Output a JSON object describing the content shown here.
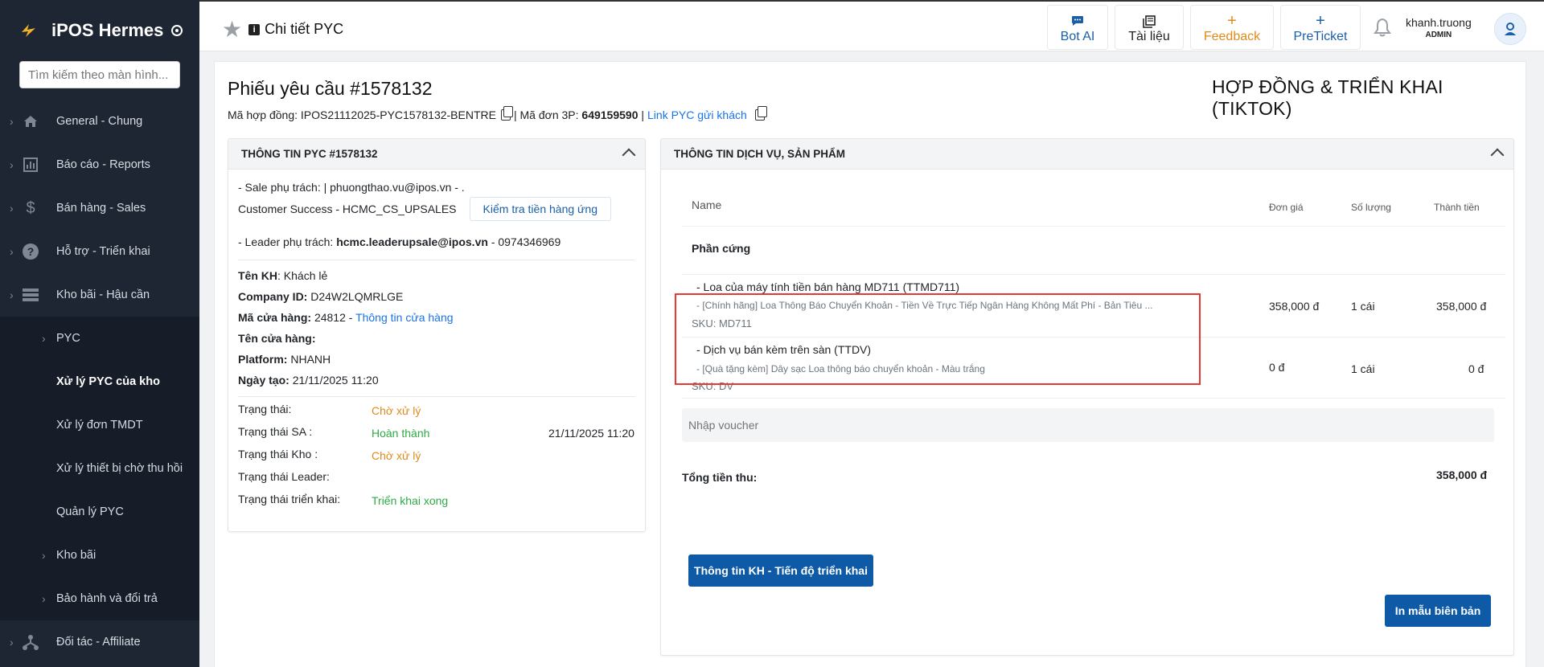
{
  "app": {
    "name": "iPOS Hermes"
  },
  "search": {
    "placeholder": "Tìm kiếm theo màn hình..."
  },
  "sidebar": {
    "items": [
      {
        "label": "General - Chung",
        "icon": "home-icon"
      },
      {
        "label": "Báo cáo - Reports",
        "icon": "report-chart-icon"
      },
      {
        "label": "Bán hàng - Sales",
        "icon": "dollar-icon"
      },
      {
        "label": "Hỗ trợ - Triển khai",
        "icon": "help-icon"
      },
      {
        "label": "Kho bãi - Hậu cần",
        "icon": "warehouse-list-icon"
      }
    ],
    "sub_items": [
      {
        "label": "PYC"
      },
      {
        "label": "Xử lý PYC của kho"
      },
      {
        "label": "Xử lý đơn TMDT"
      },
      {
        "label": "Xử lý thiết bị chờ thu hồi"
      },
      {
        "label": "Quản lý PYC"
      },
      {
        "label": "Kho bãi"
      },
      {
        "label": "Bảo hành và đổi trả"
      }
    ],
    "bottom_item": {
      "label": "Đối tác - Affiliate",
      "icon": "affiliate-icon"
    }
  },
  "topbar": {
    "title": "Chi tiết PYC",
    "buttons": [
      {
        "label": "Bot AI",
        "icon": "chat-icon"
      },
      {
        "label": "Tài liệu",
        "icon": "docs-icon"
      },
      {
        "label": "Feedback",
        "icon": "plus-icon"
      },
      {
        "label": "PreTicket",
        "icon": "plus-icon"
      }
    ],
    "user": {
      "name": "khanh.truong",
      "role": "ADMIN"
    }
  },
  "page": {
    "title": "Phiếu yêu cầu #1578132",
    "header_right": "HỢP ĐỒNG & TRIỂN KHAI (TIKTOK)",
    "contract_label": "Mã hợp đồng:",
    "contract_value": "IPOS21112025-PYC1578132-BENTRE",
    "order_label": "| Mã đơn 3P:",
    "order_value": "649159590",
    "pipe": "|",
    "link_label": "Link PYC gửi khách"
  },
  "left_panel": {
    "title": "THÔNG TIN PYC #1578132",
    "sale_line": "- Sale phụ trách: | phuongthao.vu@ipos.vn - .",
    "cs_line": "Customer Success - HCMC_CS_UPSALES",
    "check_button": "Kiểm tra tiền hàng ứng",
    "leader_prefix": "- Leader phụ trách:",
    "leader_email": "hcmc.leaderupsale@ipos.vn",
    "leader_phone": "- 0974346969",
    "customer_label": "Tên KH",
    "customer_value": ": Khách lẻ",
    "company_label": "Company ID:",
    "company_value": "D24W2LQMRLGE",
    "store_code_label": "Mã cửa hàng:",
    "store_code_value": "24812 -",
    "store_info_link": "Thông tin cửa hàng",
    "store_name_label": "Tên cửa hàng:",
    "platform_label": "Platform:",
    "platform_value": "NHANH",
    "created_label": "Ngày tạo:",
    "created_value": "21/11/2025 11:20",
    "statuses": [
      {
        "label": "Trạng thái:",
        "value": "Chờ xử lý",
        "color": "#e08a1c",
        "date": ""
      },
      {
        "label": "Trạng thái SA :",
        "value": "Hoàn thành",
        "color": "#2eaa46",
        "date": "21/11/2025 11:20"
      },
      {
        "label": "Trạng thái Kho :",
        "value": "Chờ xử lý",
        "color": "#e08a1c",
        "date": ""
      },
      {
        "label": "Trạng thái Leader:",
        "value": "",
        "color": "#212529",
        "date": ""
      },
      {
        "label": "Trạng thái triển khai:",
        "value": "Triển khai xong",
        "color": "#2eaa46",
        "date": ""
      }
    ]
  },
  "right_panel": {
    "title": "THÔNG TIN DỊCH VỤ, SẢN PHẨM",
    "columns": {
      "name": "Name",
      "price": "Đơn giá",
      "qty": "Số lượng",
      "total": "Thành tiền"
    },
    "category": "Phần cứng",
    "products": [
      {
        "name": "- Loa của máy tính tiền bán hàng MD711 (TTMD711)",
        "desc": "- [Chính hãng] Loa Thông Báo Chuyển Khoản - Tiền Về Trực Tiếp Ngân Hàng Không Mất Phí - Bản Tiêu ...",
        "sku": "SKU: MD711",
        "price": "358,000 đ",
        "qty": "1 cái",
        "total": "358,000 đ"
      },
      {
        "name": "- Dịch vụ bán kèm trên sàn (TTDV)",
        "desc": "- [Quà tặng kèm] Dây sạc Loa thông báo chuyển khoản - Màu trắng",
        "sku": "SKU: DV",
        "price": "0 đ",
        "qty": "1 cái",
        "total": "0 đ"
      }
    ],
    "voucher_placeholder": "Nhập voucher",
    "total_label": "Tổng tiền thu:",
    "total_value": "358,000 đ",
    "progress_button": "Thông tin KH - Tiến độ triển khai",
    "print_button": "In mẫu biên bản"
  },
  "colors": {
    "sidebar_bg": "#1e2633",
    "primary": "#0e5aa6",
    "highlight": "#e53935",
    "pending": "#e08a1c",
    "done": "#2eaa46"
  }
}
